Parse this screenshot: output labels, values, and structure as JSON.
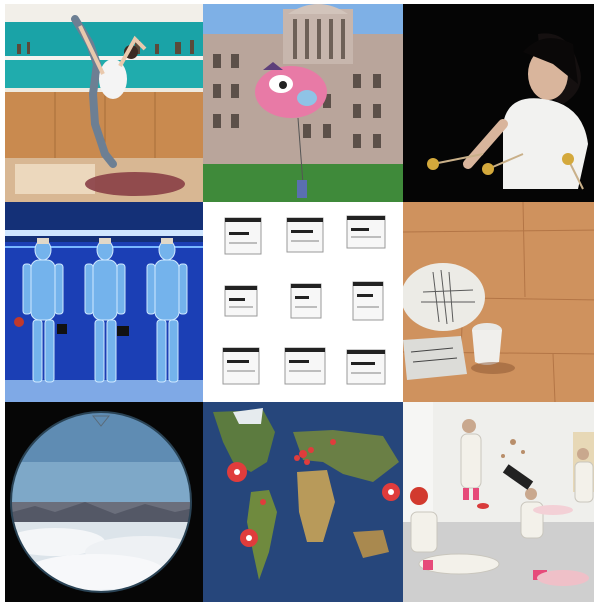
{
  "collage": {
    "tiles": [
      {
        "name": "dancer-kitchen-photo"
      },
      {
        "name": "capitol-balloon-photo"
      },
      {
        "name": "performer-mallets-photo"
      },
      {
        "name": "figures-blue-wall-photo"
      },
      {
        "name": "window-dialogs-grid-image"
      },
      {
        "name": "plate-cup-table-photo"
      },
      {
        "name": "sky-circle-porthole-photo"
      },
      {
        "name": "world-map-markers-image"
      },
      {
        "name": "gallery-performance-photo"
      }
    ]
  }
}
